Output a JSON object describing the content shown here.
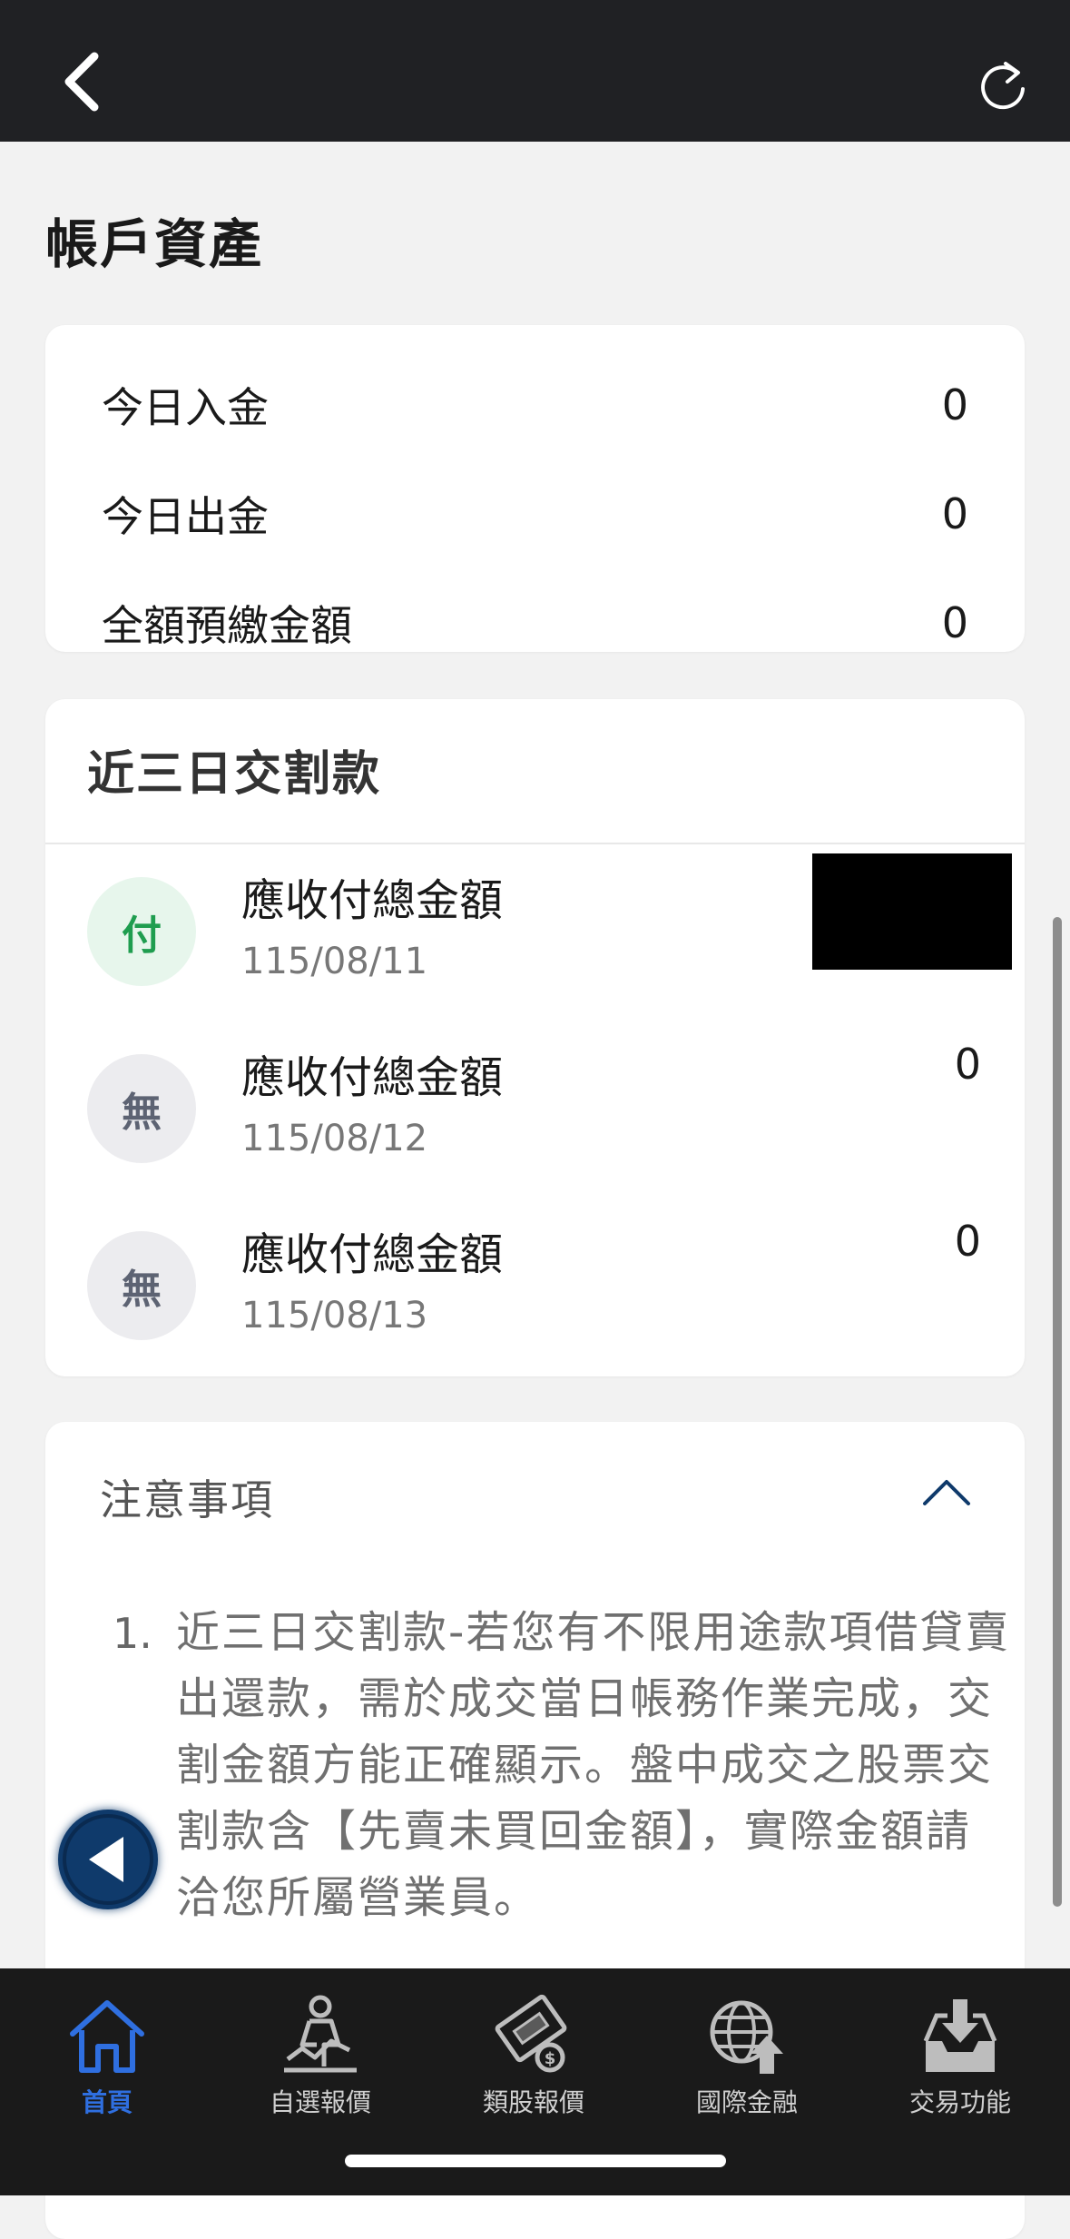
{
  "header": {
    "back_icon": "chevron-left-icon",
    "refresh_icon": "refresh-icon"
  },
  "page_title": "帳戶資產",
  "summary": {
    "rows": [
      {
        "label": "今日入金",
        "value": "0"
      },
      {
        "label": "今日出金",
        "value": "0"
      },
      {
        "label": "全額預繳金額",
        "value": "0"
      }
    ]
  },
  "settlement": {
    "title": "近三日交割款",
    "items": [
      {
        "badge": "付",
        "label": "應收付總金額",
        "date": "115/08/11",
        "amount": ""
      },
      {
        "badge": "無",
        "label": "應收付總金額",
        "date": "115/08/12",
        "amount": "0"
      },
      {
        "badge": "無",
        "label": "應收付總金額",
        "date": "115/08/13",
        "amount": "0"
      }
    ]
  },
  "notes": {
    "title": "注意事項",
    "items": [
      {
        "number": "1.",
        "text": "近三日交割款-若您有不限用途款項借貸賣出還款，需於成交當日帳務作業完成，交割金額方能正確顯示。盤中成交之股票交割款含【先賣未買回金額】，實際金額請洽您所屬營業員。"
      }
    ]
  },
  "bottom_nav": {
    "items": [
      {
        "label": "首頁",
        "icon": "home-icon",
        "active": true
      },
      {
        "label": "自選報價",
        "icon": "person-chart-icon",
        "active": false
      },
      {
        "label": "類股報價",
        "icon": "film-coin-icon",
        "active": false
      },
      {
        "label": "國際金融",
        "icon": "globe-arrow-icon",
        "active": false
      },
      {
        "label": "交易功能",
        "icon": "tray-download-icon",
        "active": false
      }
    ]
  },
  "colors": {
    "topbar": "#202124",
    "accent_blue": "#2f6fe0",
    "pay_green": "#1f9d4f",
    "float_button": "#0f3a6b"
  }
}
